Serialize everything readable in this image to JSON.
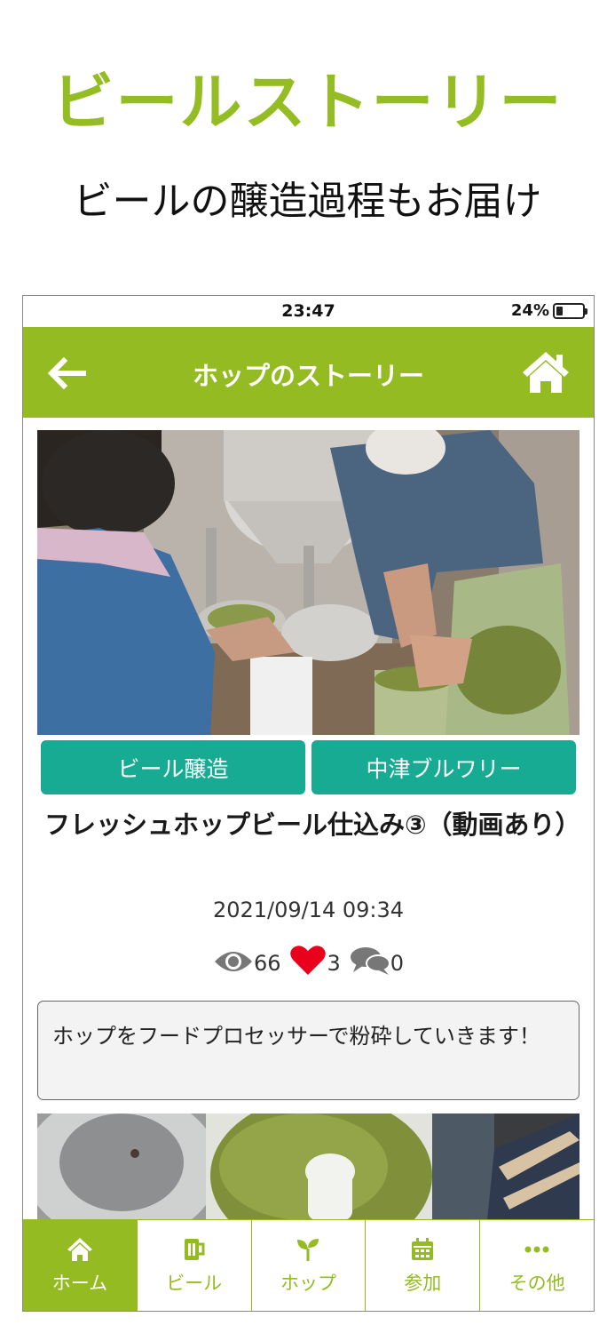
{
  "promo": {
    "title": "ビールストーリー",
    "subtitle": "ビールの醸造過程もお届け"
  },
  "status_bar": {
    "time": "23:47",
    "battery": "24%"
  },
  "header": {
    "title": "ホップのストーリー",
    "back_icon": "arrow-left-icon",
    "home_icon": "home-icon"
  },
  "post": {
    "tags": [
      "ビール醸造",
      "中津ブルワリー"
    ],
    "title": "フレッシュホップビール仕込み③（動画あり）",
    "date": "2021/09/14 09:34",
    "stats": {
      "views": "66",
      "likes": "3",
      "comments": "0"
    },
    "message": "ホップをフードプロセッサーで粉砕していきます！"
  },
  "tabs": [
    {
      "label": "ホーム",
      "icon": "home-icon",
      "active": true
    },
    {
      "label": "ビール",
      "icon": "beer-mug-icon",
      "active": false
    },
    {
      "label": "ホップ",
      "icon": "sprout-icon",
      "active": false
    },
    {
      "label": "参加",
      "icon": "calendar-icon",
      "active": false
    },
    {
      "label": "その他",
      "icon": "more-dots-icon",
      "active": false
    }
  ],
  "colors": {
    "brand_green": "#94bb22",
    "tag_teal": "#18ab94",
    "like_red": "#e8001c",
    "icon_gray": "#777777"
  }
}
